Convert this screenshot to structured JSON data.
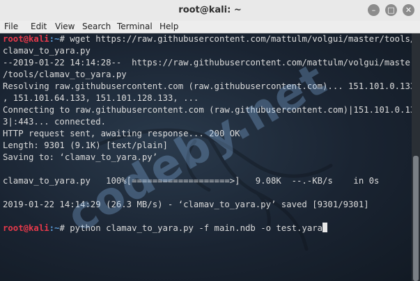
{
  "window": {
    "title": "root@kali: ~",
    "buttons": [
      "–",
      "□",
      "✕"
    ]
  },
  "menu": [
    "File",
    "Edit",
    "View",
    "Search",
    "Terminal",
    "Help"
  ],
  "prompt": {
    "user_host": "root@kali",
    "path": ":~",
    "symbol": "# "
  },
  "terminal": {
    "cmd1": "wget https://raw.githubusercontent.com/mattulm/volgui/master/tools/",
    "lines": [
      "clamav_to_yara.py",
      "--2019-01-22 14:14:28--  https://raw.githubusercontent.com/mattulm/volgui/master",
      "/tools/clamav_to_yara.py",
      "Resolving raw.githubusercontent.com (raw.githubusercontent.com)... 151.101.0.133",
      ", 151.101.64.133, 151.101.128.133, ...",
      "Connecting to raw.githubusercontent.com (raw.githubusercontent.com)|151.101.0.13",
      "3|:443... connected.",
      "HTTP request sent, awaiting response... 200 OK",
      "Length: 9301 (9.1K) [text/plain]",
      "Saving to: ‘clamav_to_yara.py’",
      "",
      "clamav_to_yara.py   100%[===================>]   9.08K  --.-KB/s    in 0s",
      "",
      "2019-01-22 14:14:29 (26.3 MB/s) - ‘clamav_to_yara.py’ saved [9301/9301]",
      ""
    ],
    "cmd2": "python clamav_to_yara.py -f main.ndb -o test.yara"
  },
  "watermark": "codeby.net"
}
